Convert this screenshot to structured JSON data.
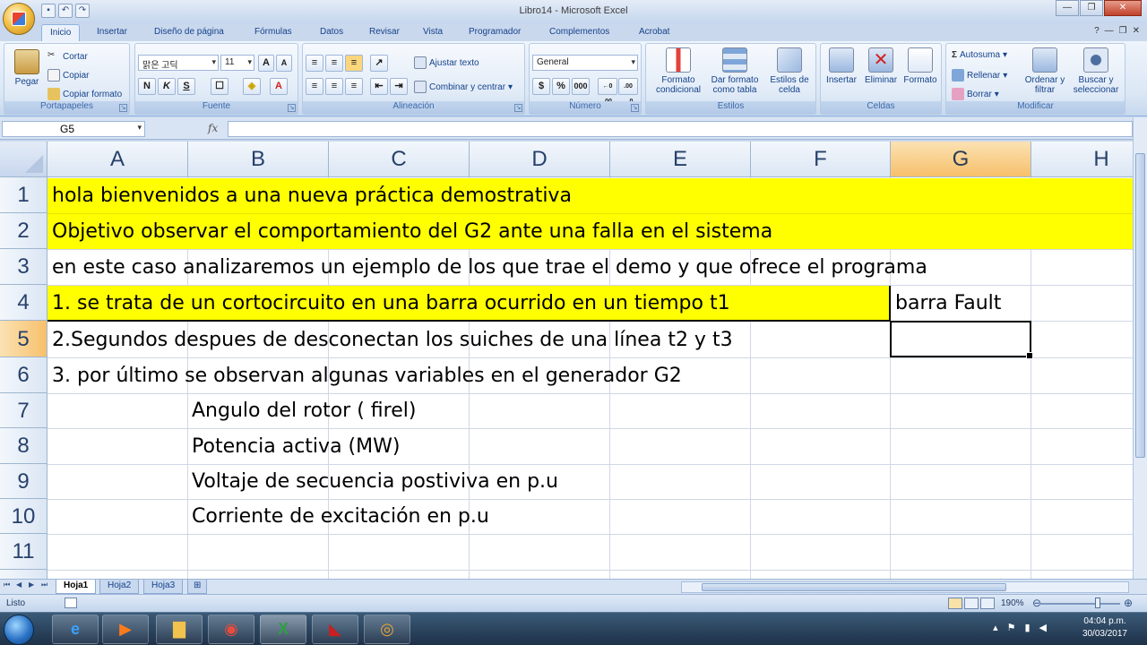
{
  "window": {
    "title": "Libro14 - Microsoft Excel"
  },
  "quick_access": {
    "save_icon": "save-icon",
    "undo_icon": "undo-icon",
    "redo_icon": "redo-icon"
  },
  "tabs": [
    "Inicio",
    "Insertar",
    "Diseño de página",
    "Fórmulas",
    "Datos",
    "Revisar",
    "Vista",
    "Programador",
    "Complementos",
    "Acrobat"
  ],
  "ribbon": {
    "clipboard": {
      "label": "Portapapeles",
      "paste": "Pegar",
      "cut": "Cortar",
      "copy": "Copiar",
      "format_painter": "Copiar formato"
    },
    "font": {
      "label": "Fuente",
      "name": "맑은 고딕",
      "size": "11",
      "bold": "N",
      "italic": "K",
      "underline": "S"
    },
    "alignment": {
      "label": "Alineación",
      "wrap": "Ajustar texto",
      "merge": "Combinar y centrar"
    },
    "number": {
      "label": "Número",
      "format": "General",
      "currency": "$",
      "percent": "%",
      "thousands": "000",
      "inc_dec": "←0 .00",
      "dec_dec": ".00 →0"
    },
    "styles": {
      "label": "Estilos",
      "cond_format": "Formato condicional",
      "table_format": "Dar formato como tabla",
      "cell_styles": "Estilos de celda"
    },
    "cells": {
      "label": "Celdas",
      "insert": "Insertar",
      "delete": "Eliminar",
      "format": "Formato"
    },
    "editing": {
      "label": "Modificar",
      "autosum": "Autosuma",
      "fill": "Rellenar",
      "clear": "Borrar",
      "sort": "Ordenar y filtrar",
      "find": "Buscar y seleccionar"
    }
  },
  "formula_bar": {
    "name_box": "G5",
    "fx": "fx",
    "value": ""
  },
  "columns": [
    "A",
    "B",
    "C",
    "D",
    "E",
    "F",
    "G",
    "H"
  ],
  "rows": [
    "1",
    "2",
    "3",
    "4",
    "5",
    "6",
    "7",
    "8",
    "9",
    "10",
    "11"
  ],
  "cells": {
    "A1": "hola bienvenidos a una nueva práctica demostrativa",
    "A2": "Objetivo observar el comportamiento del G2 ante una falla en el sistema",
    "A3": "en este caso analizaremos un ejemplo de los que trae el demo y que ofrece el programa",
    "A4": "1. se trata de un cortocircuito en una barra ocurrido en un tiempo t1",
    "G4": "barra Fault",
    "A5": "2.Segundos despues de desconectan los suiches de una línea t2 y t3",
    "A6": "3. por último se observan algunas variables en el generador G2",
    "B7": "Angulo del rotor ( firel)",
    "B8": "Potencia activa (MW)",
    "B9": "Voltaje de secuencia postiviva en p.u",
    "B10": "Corriente de excitación en p.u"
  },
  "sheets": [
    "Hoja1",
    "Hoja2",
    "Hoja3"
  ],
  "status": {
    "text": "Listo",
    "zoom": "190%"
  },
  "taskbar": {
    "time": "04:04 p.m.",
    "date": "30/03/2017"
  },
  "colors": {
    "highlight": "#ffff00",
    "selection_header": "#f7c06b"
  }
}
